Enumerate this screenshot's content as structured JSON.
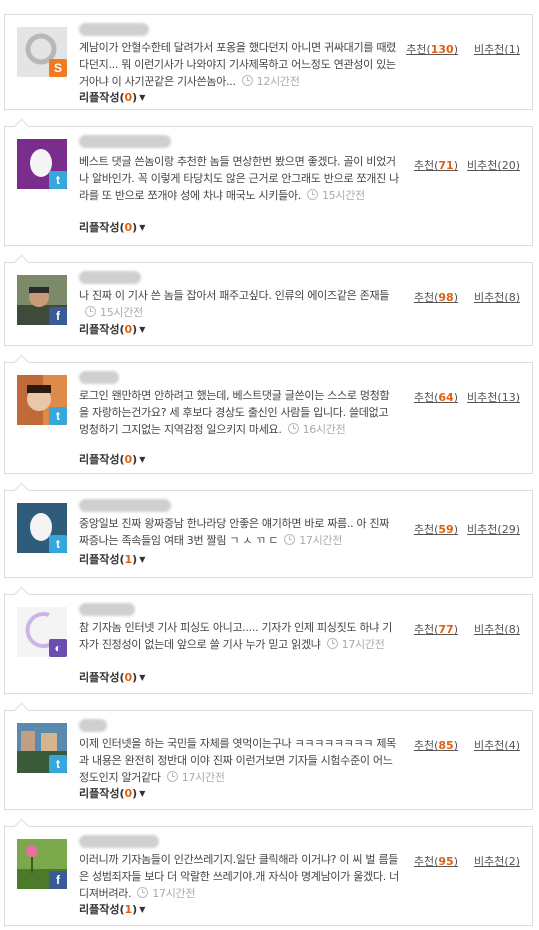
{
  "reply_label": "리플작성",
  "up_label": "추천",
  "down_label": "비추천",
  "comments": [
    {
      "sns": "s",
      "sns_icon": "sns-s-icon",
      "text": "계남이가 안혈수한테 달려가서 포옹을 했다던지 아니면 귀싸대기를 때렸다던지... 뭐 이런기사가 나와야지 기사제목하고 어느정도 연관성이 있는거아냐 이 사기꾼같은 기사쓴놈아...",
      "time": "12시간전",
      "replies": "0",
      "up": "130",
      "down": "1"
    },
    {
      "sns": "t",
      "sns_icon": "twitter-icon",
      "text": "베스트 댓글 쓴놈이랑 추천한 놈들 면상한번 봤으면 좋겠다. 골이 비었거나 알바인가. 꼭 이렇게 타당치도 않은 근거로 안그래도 반으로 쪼개진 나라를 또 반으로 쪼개야 성에 차냐 매국노 시키들아.",
      "time": "15시간전",
      "replies": "0",
      "up": "71",
      "down": "20"
    },
    {
      "sns": "f",
      "sns_icon": "facebook-icon",
      "text": "나 진짜 이 기사 쓴 놈들 잡아서 패주고싶다. 인류의 에이즈같은 존재들",
      "time": "15시간전",
      "replies": "0",
      "up": "98",
      "down": "8"
    },
    {
      "sns": "t",
      "sns_icon": "twitter-icon",
      "text": "로그인 왠만하면 안하려고 했는데, 베스트댓글 글쓴이는 스스로 멍청함을 자랑하는건가요? 세 후보다 경상도 출신인 사람들 입니다. 쓸데없고 멍청하기 그지없는 지역감정 일으키지 마세요.",
      "time": "16시간전",
      "replies": "0",
      "up": "64",
      "down": "13"
    },
    {
      "sns": "t",
      "sns_icon": "twitter-icon",
      "text": "중앙일보 진짜 왕짜증남 한나라당 안좋은 얘기하면 바로 짜름.. 아 진짜 짜증나는 족속들임 여태 3번 짤림 ㄱ ㅅ ㄲ ㄷ",
      "time": "17시간전",
      "replies": "1",
      "up": "59",
      "down": "29"
    },
    {
      "sns": "v",
      "sns_icon": "yozm-icon",
      "text": "참 기자놈 인터넷 기사 피싱도 아니고..... 기자가 인제 피싱짓도 하냐 기자가 진정성이 없는데 앞으로 쓸 기사 누가 믿고 읽겠냐",
      "time": "17시간전",
      "replies": "0",
      "up": "77",
      "down": "8"
    },
    {
      "sns": "t",
      "sns_icon": "twitter-icon",
      "text": "이제 인터넷을 하는 국민들 자체를 엿먹이는구나 ㅋㅋㅋㅋㅋㅋㅋㅋ 제목과 내용은 완전히 정반대 이야 진짜 이런거보면 기자들 시험수준이 어느정도인지 알거같다",
      "time": "17시간전",
      "replies": "0",
      "up": "85",
      "down": "4"
    },
    {
      "sns": "f",
      "sns_icon": "facebook-icon",
      "text": "이러니까 기자놈들이 인간쓰레기지.일단 클릭해라 이거냐? 이 씨 벌 름들은 성범죄자들 보다 더 악랄한 쓰레기야.개 자식아 명계남이가 울겠다. 너 디져버려라.",
      "time": "17시간전",
      "replies": "1",
      "up": "95",
      "down": "2"
    }
  ]
}
